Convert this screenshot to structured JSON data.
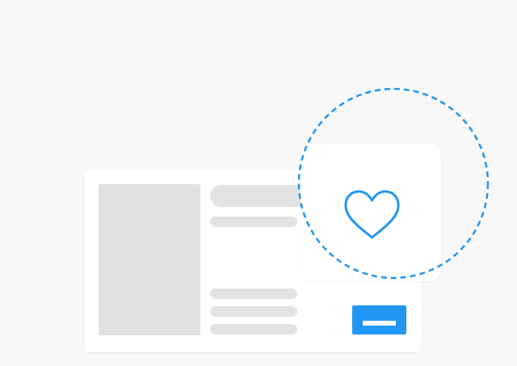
{
  "colors": {
    "background": "#f8f8f8",
    "card": "#ffffff",
    "placeholder": "#e1e1e1",
    "accent": "#2196f3"
  },
  "icons": {
    "favorite": "heart-icon",
    "highlight": "dashed-circle"
  }
}
